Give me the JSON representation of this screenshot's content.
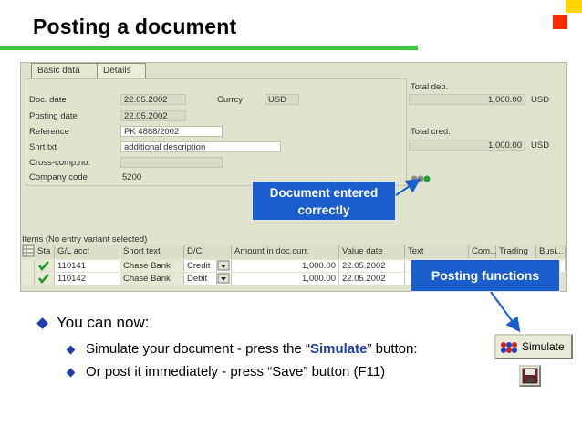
{
  "slide": {
    "title": "Posting a document",
    "colors": {
      "accent_green": "#33cc33",
      "bubble_blue": "#1a5dcc",
      "bullet_blue": "#1f3fb0",
      "simulate_text": "#1f3fb0"
    }
  },
  "tabs": [
    {
      "label": "Basic data",
      "active": true
    },
    {
      "label": "Details",
      "active": false
    }
  ],
  "header": {
    "doc_date_label": "Doc. date",
    "doc_date_value": "22.05.2002",
    "currency_label": "Currcy",
    "currency_value": "USD",
    "posting_date_label": "Posting date",
    "posting_date_value": "22.05.2002",
    "reference_label": "Reference",
    "reference_value": "PK 4888/2002",
    "short_text_label": "Shrt txt",
    "short_text_value": "additional description",
    "cross_comp_label": "Cross-comp.no.",
    "cross_comp_value": "",
    "company_code_label": "Company code",
    "company_code_value": "5200",
    "total_debit_label": "Total deb.",
    "total_debit_value": "1,000.00",
    "total_debit_currency": "USD",
    "total_credit_label": "Total cred.",
    "total_credit_value": "1,000.00",
    "total_credit_currency": "USD"
  },
  "callouts": {
    "document_entered_line1": "Document entered",
    "document_entered_line2": "correctly",
    "posting_functions": "Posting functions"
  },
  "items": {
    "title": "Items (No entry variant selected)",
    "columns": [
      "Sta",
      "G/L acct",
      "Short text",
      "D/C",
      "Amount in doc.curr.",
      "Value date",
      "Text",
      "Com...",
      "Trading",
      "Busi..."
    ],
    "rows": [
      {
        "gl": "110141",
        "short_text": "Chase Bank",
        "dc": "Credit",
        "amount": "1,000.00",
        "value_date": "22.05.2002"
      },
      {
        "gl": "110142",
        "short_text": "Chase Bank",
        "dc": "Debit",
        "amount": "1,000.00",
        "value_date": "22.05.2002"
      }
    ]
  },
  "bullets": {
    "main": "You can now:",
    "sub1_before": "Simulate your document - press the “",
    "sub1_highlight": "Simulate",
    "sub1_after": "” button:",
    "sub2": "Or post it immediately - press “Save” button (F11)"
  },
  "buttons": {
    "simulate_label": "Simulate",
    "simulate_icon": "simulate-icon",
    "save_icon": "floppy-disk-icon"
  }
}
